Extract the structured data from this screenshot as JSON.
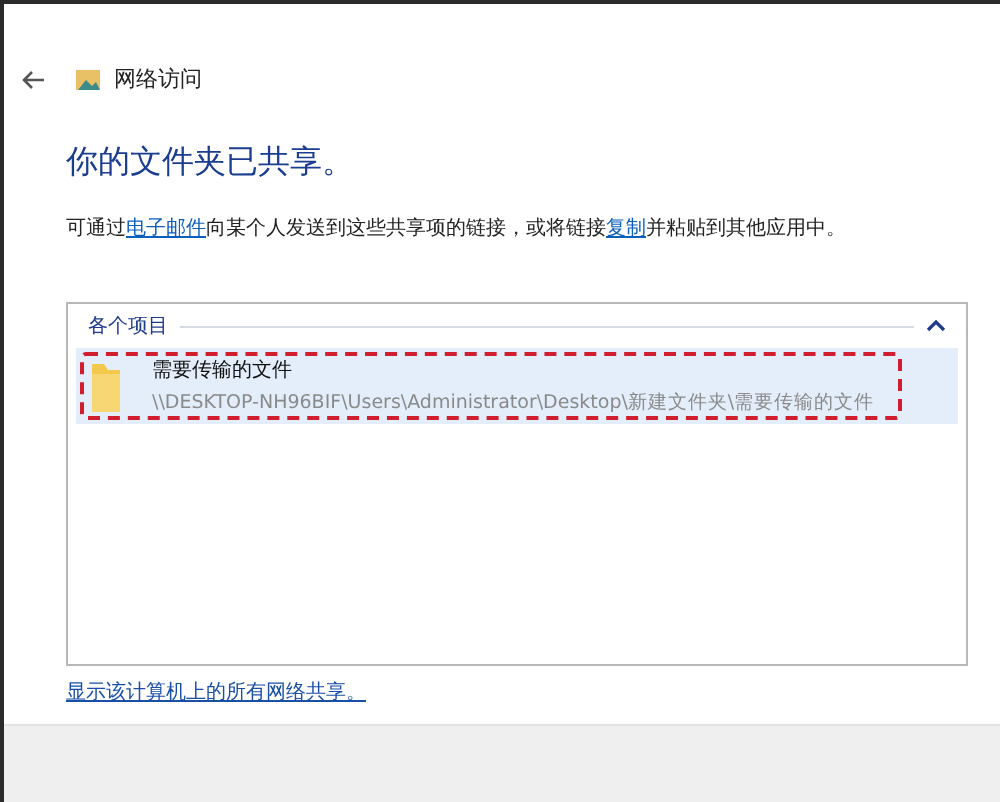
{
  "window": {
    "title": "网络访问"
  },
  "heading": "你的文件夹已共享。",
  "description": [
    {
      "kind": "text",
      "text": "可通过"
    },
    {
      "kind": "link",
      "text": "电子邮件"
    },
    {
      "kind": "text",
      "text": "向某个人发送到这些共享项的链接，或将链接"
    },
    {
      "kind": "link",
      "text": "复制"
    },
    {
      "kind": "text",
      "text": "并粘贴到其他应用中。"
    }
  ],
  "group": {
    "title": "各个项目",
    "expanded": true,
    "items": [
      {
        "name": "需要传输的文件",
        "path": "\\\\DESKTOP-NH96BIF\\Users\\Administrator\\Desktop\\新建文件夹\\需要传输的文件",
        "selected": true,
        "highlighted": true
      }
    ]
  },
  "footer_link": "显示该计算机上的所有网络共享。"
}
